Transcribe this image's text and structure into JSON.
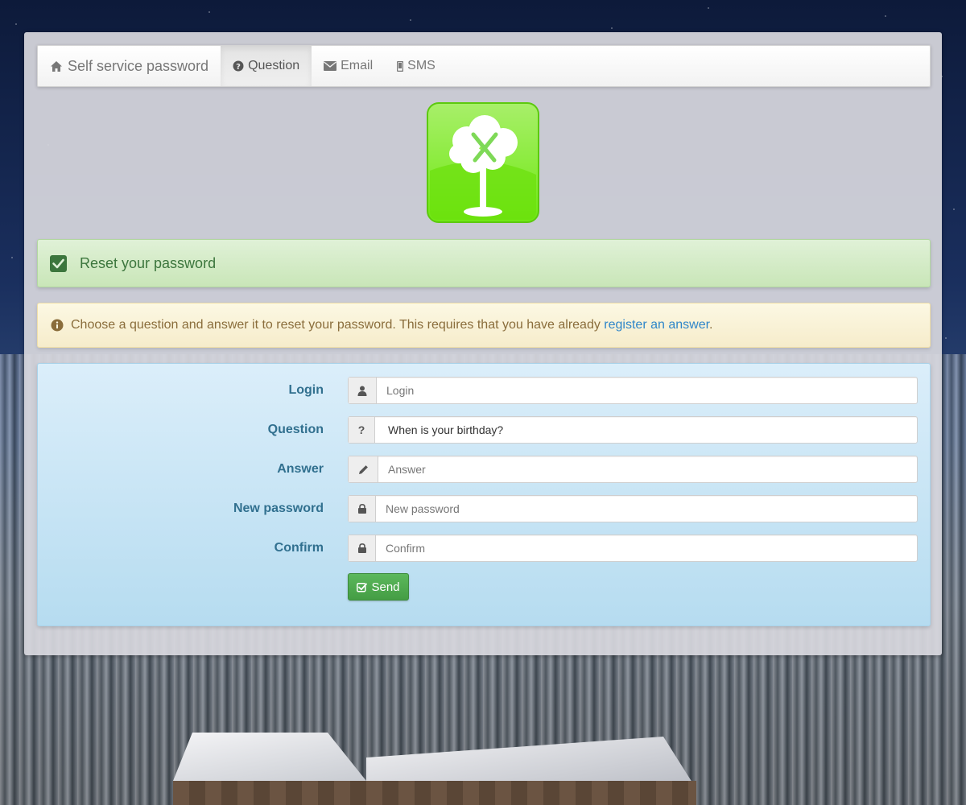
{
  "navbar": {
    "brand": "Self service password",
    "brand_icon": "home-icon",
    "items": [
      {
        "label": "Question",
        "icon": "question-circle-icon",
        "active": true
      },
      {
        "label": "Email",
        "icon": "envelope-icon",
        "active": false
      },
      {
        "label": "SMS",
        "icon": "mobile-icon",
        "active": false
      }
    ]
  },
  "logo": {
    "icon": "tree-logo-icon"
  },
  "alert_success": {
    "text": "Reset your password",
    "icon": "check-square-icon"
  },
  "alert_info": {
    "icon": "info-circle-icon",
    "text_before": "Choose a question and answer it to reset your password. This requires that you have already ",
    "link": "register an answer",
    "text_after": "."
  },
  "form": {
    "login": {
      "label": "Login",
      "placeholder": "Login",
      "icon": "user-icon"
    },
    "question": {
      "label": "Question",
      "value": "When is your birthday?",
      "icon": "question-mark-icon"
    },
    "answer": {
      "label": "Answer",
      "placeholder": "Answer",
      "icon": "pencil-icon"
    },
    "new_password": {
      "label": "New password",
      "placeholder": "New password",
      "icon": "lock-icon"
    },
    "confirm": {
      "label": "Confirm",
      "placeholder": "Confirm",
      "icon": "lock-icon"
    },
    "submit": {
      "label": "Send",
      "icon": "check-square-o-icon"
    }
  },
  "colors": {
    "success_text": "#3c763d",
    "warning_text": "#8a6d3b",
    "link": "#2f86c9",
    "label": "#31708f",
    "button": "#5cb85c",
    "logo_green": "#7ed957"
  }
}
